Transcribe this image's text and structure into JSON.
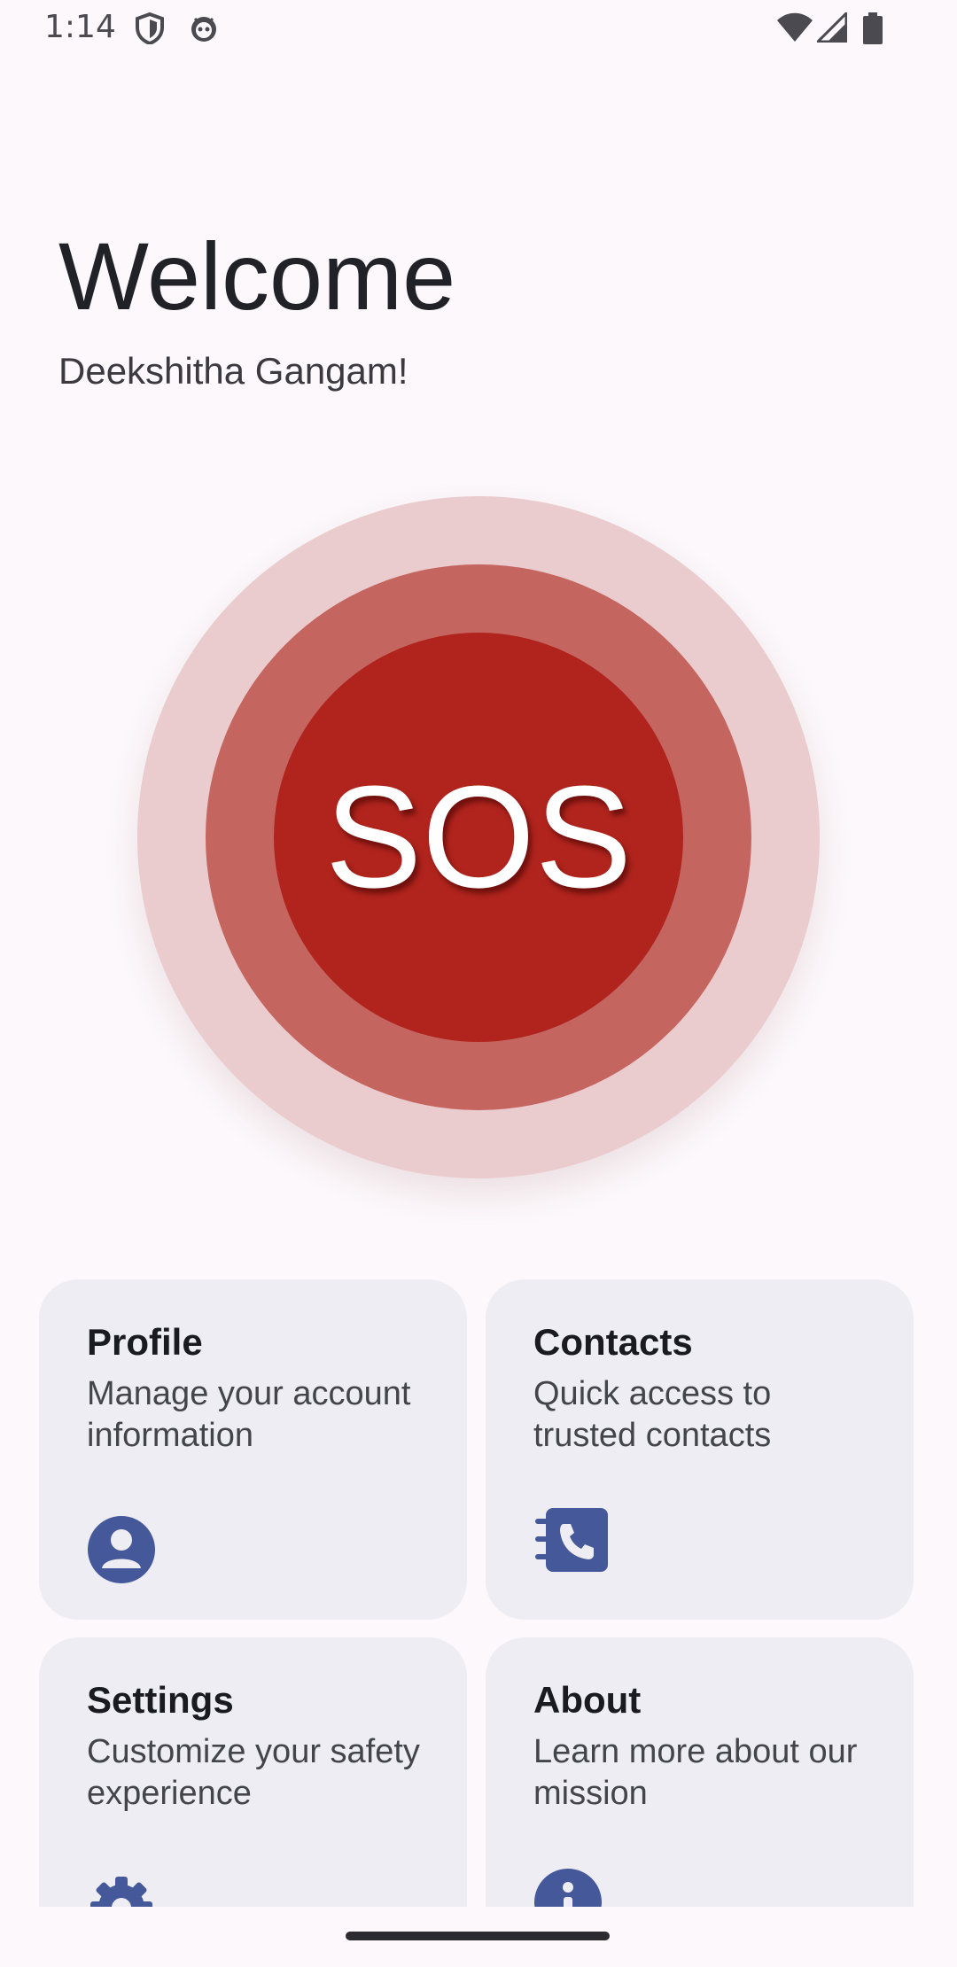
{
  "status_bar": {
    "time": "1:14",
    "icons_left": [
      "shield-icon",
      "robot-face-icon"
    ],
    "icons_right": [
      "wifi-icon",
      "cell-signal-icon",
      "battery-icon"
    ]
  },
  "header": {
    "title": "Welcome",
    "user_name": "Deekshitha Gangam!"
  },
  "sos": {
    "label": "SOS",
    "colors": {
      "outer": "#eacbce",
      "middle": "#c56560",
      "inner": "#b0241d"
    }
  },
  "cards": [
    {
      "title": "Profile",
      "description": "Manage your account information",
      "icon": "account-circle-icon"
    },
    {
      "title": "Contacts",
      "description": "Quick access to trusted contacts",
      "icon": "contacts-book-icon"
    },
    {
      "title": "Settings",
      "description": "Customize your safety experience",
      "icon": "gear-icon"
    },
    {
      "title": "About",
      "description": "Learn more about our mission",
      "icon": "info-icon"
    }
  ],
  "accent_color": "#44589a"
}
